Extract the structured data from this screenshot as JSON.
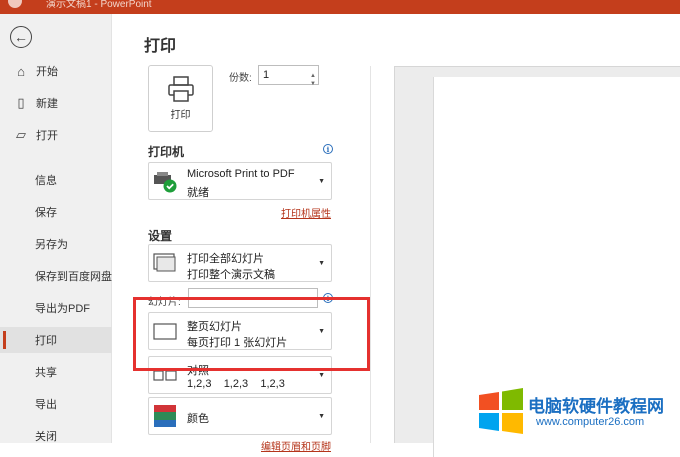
{
  "titlebar": {
    "title": "演示文稿1 - PowerPoint"
  },
  "nav": {
    "back_icon": "arrow-left-icon",
    "items": [
      {
        "label": "开始",
        "icon": "home-icon"
      },
      {
        "label": "新建",
        "icon": "new-file-icon"
      },
      {
        "label": "打开",
        "icon": "folder-open-icon"
      },
      {
        "label": "信息"
      },
      {
        "label": "保存"
      },
      {
        "label": "另存为"
      },
      {
        "label": "保存到百度网盘"
      },
      {
        "label": "导出为PDF"
      },
      {
        "label": "打印",
        "active": true
      },
      {
        "label": "共享"
      },
      {
        "label": "导出"
      },
      {
        "label": "关闭"
      }
    ]
  },
  "main": {
    "title": "打印",
    "print_button": "打印",
    "copies_label": "份数:",
    "copies_value": "1",
    "printer_section": "打印机",
    "printer": {
      "name": "Microsoft Print to PDF",
      "status": "就绪"
    },
    "printer_props": "打印机属性",
    "settings_section": "设置",
    "slides_range": {
      "line1": "打印全部幻灯片",
      "line2": "打印整个演示文稿"
    },
    "slides_label": "幻灯片:",
    "layout": {
      "line1": "整页幻灯片",
      "line2": "每页打印 1 张幻灯片"
    },
    "collate": {
      "line1": "对照",
      "line2": "1,2,3    1,2,3    1,2,3"
    },
    "color": "颜色",
    "edit_header_footer": "编辑页眉和页脚"
  },
  "watermark": {
    "line1": "电脑软硬件教程网",
    "line2": "www.computer26.com"
  },
  "colors": {
    "accent": "#c43e1c",
    "highlight": "#e5312f",
    "link": "#b5351b"
  }
}
